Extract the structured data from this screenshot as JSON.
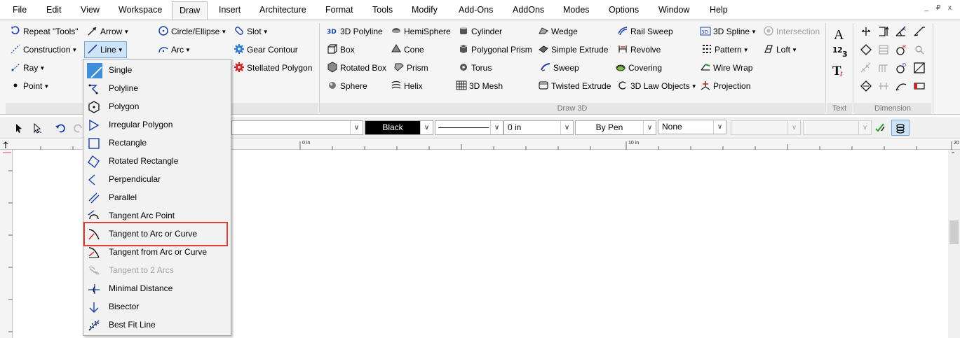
{
  "menu": {
    "items": [
      "File",
      "Edit",
      "View",
      "Workspace",
      "Draw",
      "Insert",
      "Architecture",
      "Format",
      "Tools",
      "Modify",
      "Add-Ons",
      "AddOns",
      "Modes",
      "Options",
      "Window",
      "Help"
    ],
    "active": "Draw",
    "window_controls": "_ ₽ x"
  },
  "ribbon": {
    "draw2d": {
      "repeat": "Repeat \"Tools\"",
      "construction": "Construction",
      "ray": "Ray",
      "point": "Point",
      "arrow": "Arrow",
      "line": "Line",
      "circle_ellipse": "Circle/Ellipse",
      "arc": "Arc",
      "slot": "Slot",
      "gear_contour": "Gear Contour",
      "stellated_polygon": "Stellated Polygon"
    },
    "draw3d": {
      "polyline3d": "3D Polyline",
      "box": "Box",
      "rotated_box": "Rotated Box",
      "sphere": "Sphere",
      "hemisphere": "HemiSphere",
      "cone": "Cone",
      "prism": "Prism",
      "helix": "Helix",
      "cylinder": "Cylinder",
      "polygonal_prism": "Polygonal Prism",
      "torus": "Torus",
      "mesh3d": "3D Mesh",
      "wedge": "Wedge",
      "simple_extrude": "Simple Extrude",
      "sweep": "Sweep",
      "twisted_extrude": "Twisted Extrude",
      "rail_sweep": "Rail Sweep",
      "revolve": "Revolve",
      "covering": "Covering",
      "law_objects3d": "3D Law Objects",
      "spline3d": "3D Spline",
      "pattern": "Pattern",
      "wire_wrap": "Wire Wrap",
      "projection": "Projection",
      "intersection": "Intersection",
      "loft": "Loft",
      "group_label": "Draw 3D"
    },
    "text_group_label": "Text",
    "dimension_group_label": "Dimension"
  },
  "toolbar": {
    "color": "Black",
    "line_width": "0 in",
    "pen": "By Pen",
    "fill": "None"
  },
  "ruler": {
    "mark0": "0 in",
    "mark10": "10 in",
    "mark20": "20"
  },
  "dropdown": {
    "items": [
      {
        "label": "Single",
        "icon": "single-line-icon"
      },
      {
        "label": "Polyline",
        "icon": "polyline-icon"
      },
      {
        "label": "Polygon",
        "icon": "polygon-icon"
      },
      {
        "label": "Irregular Polygon",
        "icon": "irregular-polygon-icon"
      },
      {
        "label": "Rectangle",
        "icon": "rectangle-icon"
      },
      {
        "label": "Rotated Rectangle",
        "icon": "rotated-rectangle-icon"
      },
      {
        "label": "Perpendicular",
        "icon": "perpendicular-icon"
      },
      {
        "label": "Parallel",
        "icon": "parallel-icon"
      },
      {
        "label": "Tangent Arc Point",
        "icon": "tangent-arc-point-icon"
      },
      {
        "label": "Tangent to Arc or Curve",
        "icon": "tangent-to-arc-icon"
      },
      {
        "label": "Tangent from Arc or Curve",
        "icon": "tangent-from-arc-icon"
      },
      {
        "label": "Tangent to 2 Arcs",
        "icon": "tangent-2-arcs-icon"
      },
      {
        "label": "Minimal Distance",
        "icon": "minimal-distance-icon"
      },
      {
        "label": "Bisector",
        "icon": "bisector-icon"
      },
      {
        "label": "Best Fit Line",
        "icon": "best-fit-line-icon"
      }
    ],
    "highlighted": "Tangent to Arc or Curve"
  },
  "colors": {
    "icon_blue": "#1a3fa8",
    "highlight_red": "#e0403a",
    "selected_blue": "#3f8fd8"
  }
}
